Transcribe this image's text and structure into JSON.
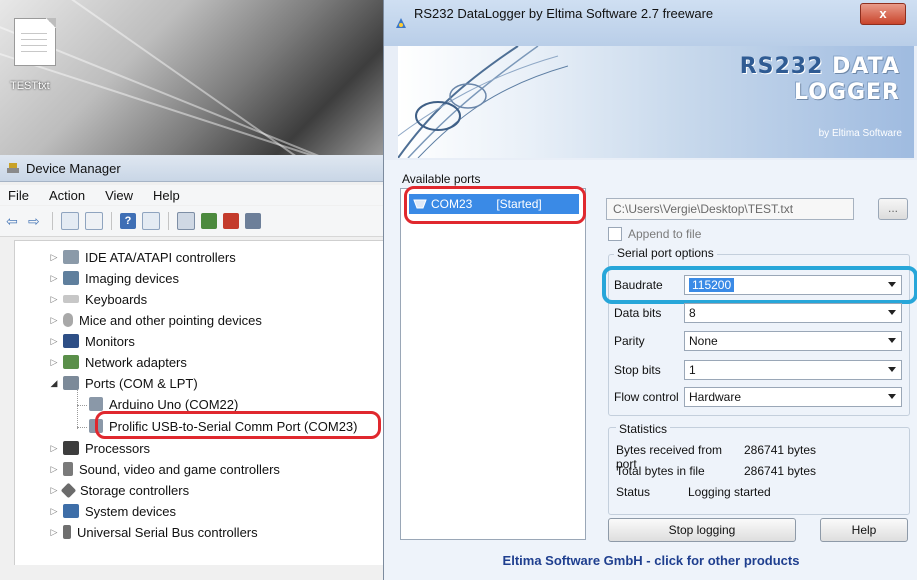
{
  "desktop": {
    "file_icon_label": "TESTtxt"
  },
  "device_manager": {
    "title": "Device Manager",
    "menu": [
      "File",
      "Action",
      "View",
      "Help"
    ],
    "tree": [
      {
        "label": "IDE ATA/ATAPI controllers",
        "icon": "ide-controller-icon",
        "expanded": false
      },
      {
        "label": "Imaging devices",
        "icon": "imaging-device-icon",
        "expanded": false
      },
      {
        "label": "Keyboards",
        "icon": "keyboard-icon",
        "expanded": false
      },
      {
        "label": "Mice and other pointing devices",
        "icon": "mouse-icon",
        "expanded": false
      },
      {
        "label": "Monitors",
        "icon": "monitor-icon",
        "expanded": false
      },
      {
        "label": "Network adapters",
        "icon": "network-adapter-icon",
        "expanded": false
      },
      {
        "label": "Ports (COM & LPT)",
        "icon": "ports-icon",
        "expanded": true
      },
      {
        "label": "Arduino Uno (COM22)",
        "icon": "port-device-icon",
        "child": true
      },
      {
        "label": "Prolific USB-to-Serial Comm Port (COM23)",
        "icon": "port-device-icon",
        "child": true
      },
      {
        "label": "Processors",
        "icon": "processor-icon",
        "expanded": false
      },
      {
        "label": "Sound, video and game controllers",
        "icon": "sound-icon",
        "expanded": false
      },
      {
        "label": "Storage controllers",
        "icon": "storage-icon",
        "expanded": false
      },
      {
        "label": "System devices",
        "icon": "system-device-icon",
        "expanded": false
      },
      {
        "label": "Universal Serial Bus controllers",
        "icon": "usb-icon",
        "expanded": false
      }
    ]
  },
  "rs232": {
    "title": "RS232 DataLogger by Eltima Software 2.7  freeware",
    "close_label": "x",
    "banner": {
      "line1a": "RS232",
      "line1b": " DATA",
      "line2": "LOGGER",
      "by": "by Eltima Software"
    },
    "available_ports_label": "Available ports",
    "port": {
      "name": "COM23",
      "status": "[Started]"
    },
    "file_path": "C:\\Users\\Vergie\\Desktop\\TEST.txt",
    "browse_label": "...",
    "append_label": "Append to file",
    "serial_group_label": "Serial port options",
    "options": {
      "baudrate": {
        "label": "Baudrate",
        "value": "115200"
      },
      "data_bits": {
        "label": "Data bits",
        "value": "8"
      },
      "parity": {
        "label": "Parity",
        "value": "None"
      },
      "stop_bits": {
        "label": "Stop bits",
        "value": "1"
      },
      "flow_control": {
        "label": "Flow control",
        "value": "Hardware"
      }
    },
    "statistics": {
      "label": "Statistics",
      "bytes_received_label": "Bytes received from port",
      "bytes_received_value": "286741 bytes",
      "total_bytes_label": "Total bytes in file",
      "total_bytes_value": "286741 bytes",
      "status_label": "Status",
      "status_value": "Logging started"
    },
    "stop_button": "Stop logging",
    "help_button": "Help",
    "footer_link": "Eltima Software GmbH - click for other products"
  },
  "colors": {
    "highlight_blue": "#3a8ae6",
    "annotation_red": "#e0282e",
    "annotation_cyan": "#27a6d9",
    "link_blue": "#1f3f8f"
  }
}
